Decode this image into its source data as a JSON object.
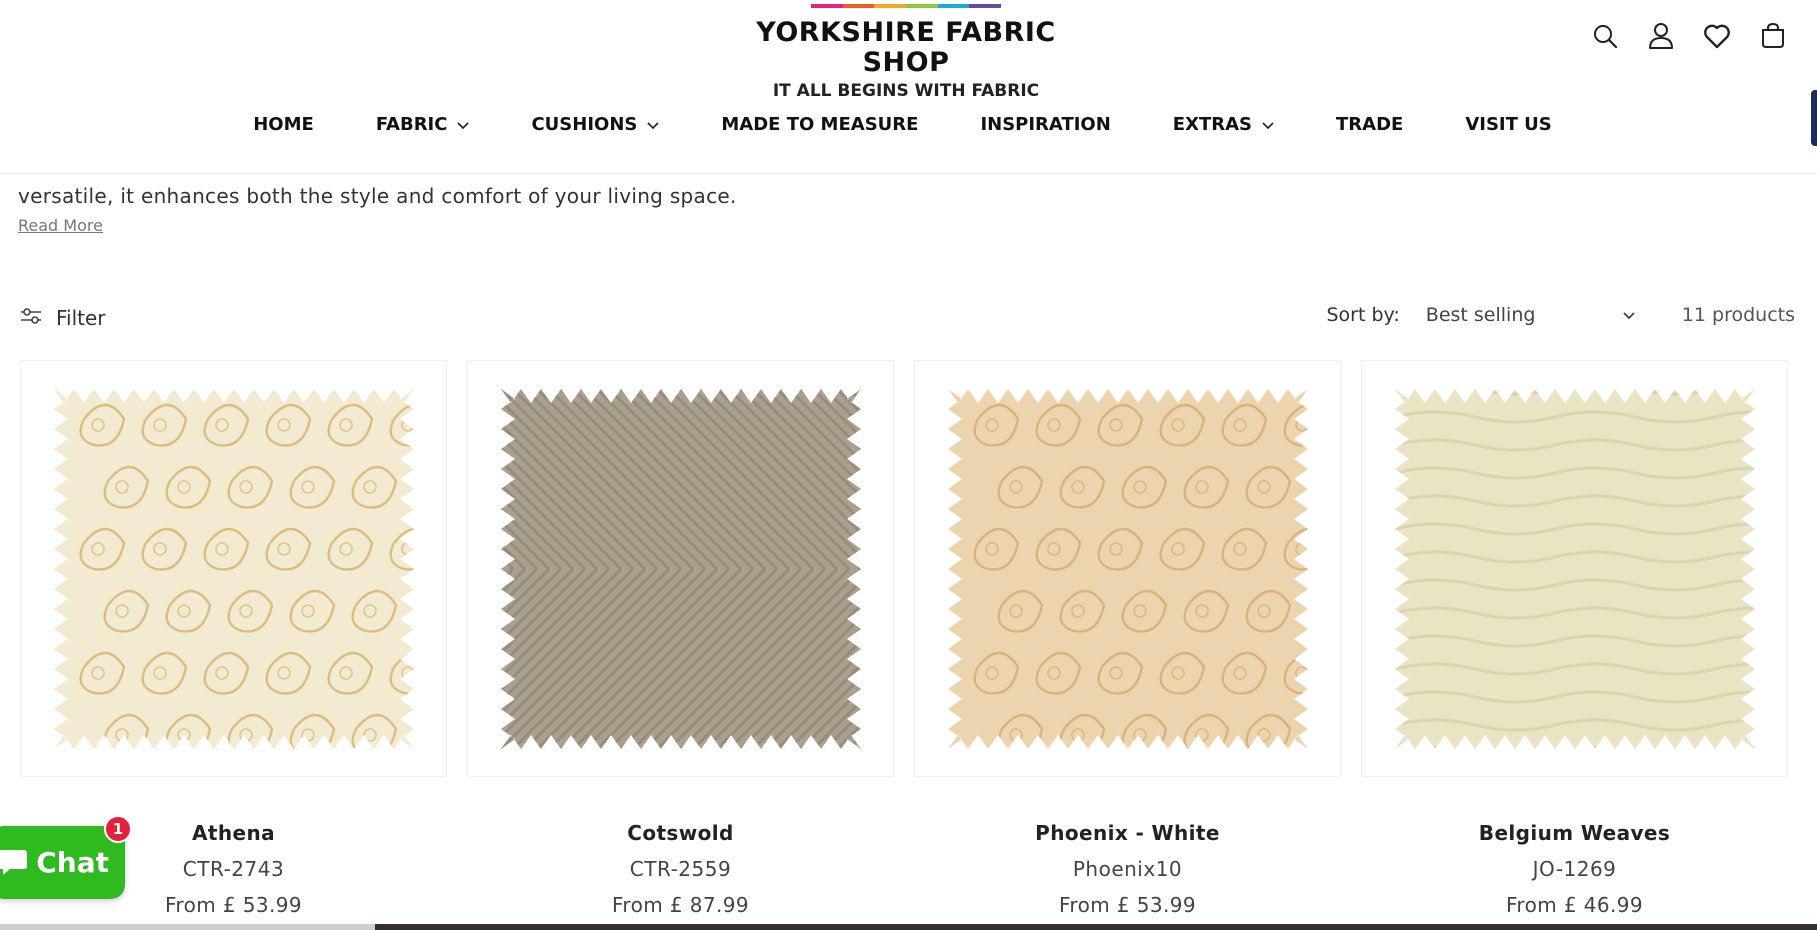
{
  "brand": {
    "title": "YORKSHIRE FABRIC SHOP",
    "tagline": "IT ALL BEGINS WITH FABRIC",
    "stripe_colors": [
      "#e8237a",
      "#f15a2b",
      "#f7a823",
      "#8dc63f",
      "#20a9e1",
      "#6a4aa0"
    ]
  },
  "header_icons": [
    "search-icon",
    "account-icon",
    "wishlist-heart-icon",
    "cart-icon"
  ],
  "nav": {
    "items": [
      {
        "label": "HOME",
        "dropdown": false
      },
      {
        "label": "FABRIC",
        "dropdown": true
      },
      {
        "label": "CUSHIONS",
        "dropdown": true
      },
      {
        "label": "MADE TO MEASURE",
        "dropdown": false
      },
      {
        "label": "INSPIRATION",
        "dropdown": false
      },
      {
        "label": "EXTRAS",
        "dropdown": true
      },
      {
        "label": "TRADE",
        "dropdown": false
      },
      {
        "label": "VISIT US",
        "dropdown": false
      }
    ]
  },
  "collection": {
    "description": "versatile, it enhances both the style and comfort of your living space.",
    "read_more": "Read More"
  },
  "toolbar": {
    "filter_label": "Filter",
    "sort_label": "Sort by:",
    "sort_value": "Best selling",
    "product_count": "11 products"
  },
  "products": [
    {
      "title": "Athena",
      "sku": "CTR-2743",
      "price": "From £ 53.99",
      "swatch": {
        "base": "#f3ead2",
        "accent": "#d8b56f",
        "pattern": "paisley"
      }
    },
    {
      "title": "Cotswold",
      "sku": "CTR-2559",
      "price": "From £ 87.99",
      "swatch": {
        "base": "#a9a18e",
        "accent": "#8a8270",
        "pattern": "herringbone"
      }
    },
    {
      "title": "Phoenix - White",
      "sku": "Phoenix10",
      "price": "From £ 53.99",
      "swatch": {
        "base": "#ecd4ae",
        "accent": "#d2ae72",
        "pattern": "paisley"
      }
    },
    {
      "title": "Belgium Weaves",
      "sku": "JO-1269",
      "price": "From £ 46.99",
      "swatch": {
        "base": "#e8e4c4",
        "accent": "#d6d1ab",
        "pattern": "weave"
      }
    }
  ],
  "chat": {
    "label": "Chat",
    "badge": "1",
    "color": "#2fba20"
  }
}
